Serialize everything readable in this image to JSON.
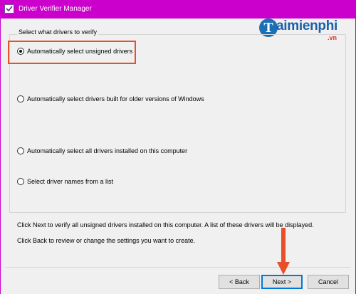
{
  "window": {
    "title": "Driver Verifier Manager",
    "frame_color": "#cc00cc"
  },
  "watermark": {
    "mark": "T",
    "word": "aimienphi",
    "sub": ".vn"
  },
  "group": {
    "label": "Select what drivers to verify"
  },
  "options": [
    {
      "label": "Automatically select unsigned drivers",
      "checked": true
    },
    {
      "label": "Automatically select drivers built for older versions of Windows",
      "checked": false
    },
    {
      "label": "Automatically select all drivers installed on this computer",
      "checked": false
    },
    {
      "label": "Select driver names from a list",
      "checked": false
    }
  ],
  "info": {
    "line1": "Click Next to verify all unsigned drivers installed on this computer. A list of these drivers will be displayed.",
    "line2": "Click Back to review or change the settings you want to create."
  },
  "buttons": {
    "back": "< Back",
    "next": "Next >",
    "cancel": "Cancel"
  },
  "annotation_color": "#e8502a"
}
